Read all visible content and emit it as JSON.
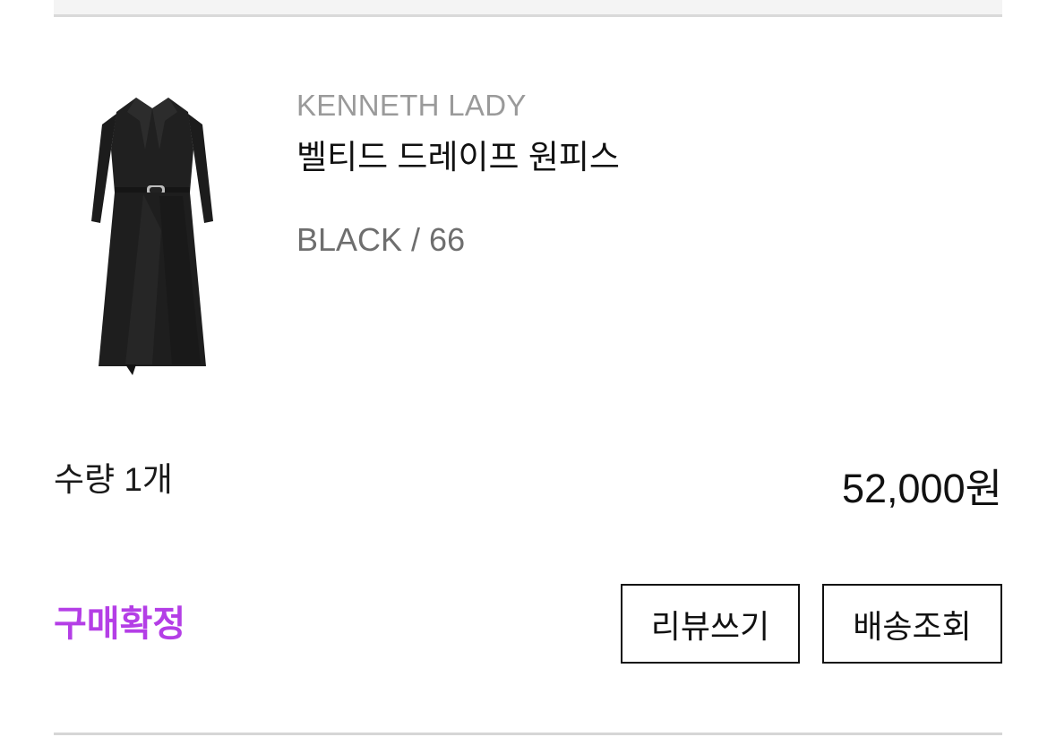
{
  "order_item": {
    "brand": "KENNETH LADY",
    "product_name": "벨티드 드레이프 원피스",
    "option": "BLACK / 66",
    "quantity_label": "수량 1개",
    "price": "52,000원",
    "status": "구매확정",
    "image_icon": "black-dress-image",
    "status_color": "#b43ee6"
  },
  "actions": {
    "review_label": "리뷰쓰기",
    "track_label": "배송조회"
  }
}
